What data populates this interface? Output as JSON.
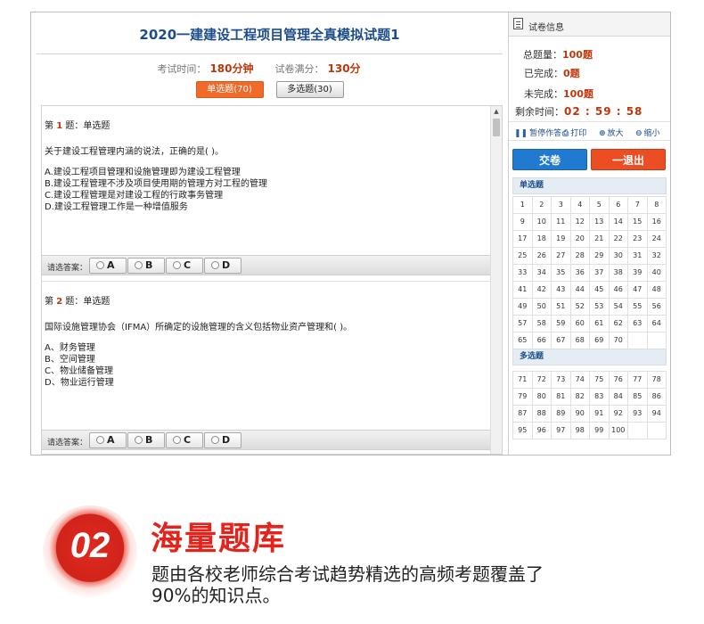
{
  "exam": {
    "title": "2020一建建设工程项目管理全真模拟试题1",
    "time_label": "考试时间：",
    "time_value": "180分钟",
    "score_label": "试卷满分：",
    "score_value": "130分",
    "tabs": [
      {
        "label": "单选题(70)",
        "active": true
      },
      {
        "label": "多选题(30)",
        "active": false
      }
    ]
  },
  "questions": [
    {
      "prefix": "第 ",
      "num": "1",
      "suffix": " 题：单选题",
      "stem": "关于建设工程管理内涵的说法，正确的是( )。",
      "options": [
        "A.建设工程项目管理和设施管理即为建设工程管理",
        "B.建设工程管理不涉及项目使用期的管理方对工程的管理",
        "C.建设工程管理是对建设工程的行政事务管理",
        "D.建设工程管理工作是一种增值服务"
      ],
      "answer_label": "请选答案：",
      "answer_choices": [
        "A",
        "B",
        "C",
        "D"
      ]
    },
    {
      "prefix": "第 ",
      "num": "2",
      "suffix": " 题：单选题",
      "stem": "国际设施管理协会（IFMA）所确定的设施管理的含义包括物业资产管理和( )。",
      "options": [
        "A、财务管理",
        "B、空间管理",
        "C、物业储备管理",
        "D、物业运行管理"
      ],
      "answer_label": "请选答案：",
      "answer_choices": [
        "A",
        "B",
        "C",
        "D"
      ]
    }
  ],
  "sidebar": {
    "title": "试卷信息",
    "total_label": "总题量：",
    "total_value": "100题",
    "done_label": "已完成：",
    "done_value": "0题",
    "undone_label": "未完成：",
    "undone_value": "100题",
    "time_left_label": "剩余时间：",
    "time_left_value": "02 : 59 : 58",
    "tools": {
      "pause": "暂停作答",
      "print": "打印",
      "zoom_in": "放大",
      "zoom_out": "缩小"
    },
    "submit_label": "交卷",
    "exit_label": "一退出",
    "single_section_label": "单选题",
    "multi_section_label": "多选题",
    "single_numbers": [
      "1",
      "2",
      "3",
      "4",
      "5",
      "6",
      "7",
      "8",
      "9",
      "10",
      "11",
      "12",
      "13",
      "14",
      "15",
      "16",
      "17",
      "18",
      "19",
      "20",
      "21",
      "22",
      "23",
      "24",
      "25",
      "26",
      "27",
      "28",
      "29",
      "30",
      "31",
      "32",
      "33",
      "34",
      "35",
      "36",
      "37",
      "38",
      "39",
      "40",
      "41",
      "42",
      "43",
      "44",
      "45",
      "46",
      "47",
      "48",
      "49",
      "50",
      "51",
      "52",
      "53",
      "54",
      "55",
      "56",
      "57",
      "58",
      "59",
      "60",
      "61",
      "62",
      "63",
      "64",
      "65",
      "66",
      "67",
      "68",
      "69",
      "70"
    ],
    "multi_numbers": [
      "71",
      "72",
      "73",
      "74",
      "75",
      "76",
      "77",
      "78",
      "79",
      "80",
      "81",
      "82",
      "83",
      "84",
      "85",
      "86",
      "87",
      "88",
      "89",
      "90",
      "91",
      "92",
      "93",
      "94",
      "95",
      "96",
      "97",
      "98",
      "99",
      "100"
    ]
  },
  "feature": {
    "badge": "02",
    "title": "海量题库",
    "desc_line1": "题由各校老师综合考试趋势精选的高频考题覆盖了",
    "desc_line2": "90%的知识点。"
  },
  "colors": {
    "accent_red": "#c0360c",
    "title_blue": "#1d4e89",
    "submit_blue": "#1f7ad0",
    "exit_orange": "#ec4e23",
    "active_tab": "#f06a2a",
    "feature_red": "#e3241d"
  },
  "icons": {
    "sidebar": "document-icon",
    "pause": "pause-icon",
    "print": "printer-icon",
    "zoom_in": "zoom-in-icon",
    "zoom_out": "zoom-out-icon",
    "scroll_up": "scroll-up-arrow-icon",
    "radio": "radio-button-icon"
  }
}
